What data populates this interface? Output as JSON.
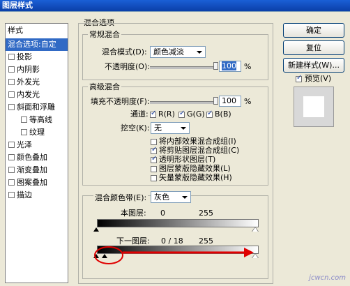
{
  "window": {
    "title": "图层样式"
  },
  "sidebar": {
    "header": "样式",
    "items": [
      {
        "label": "混合选项:自定",
        "selected": true,
        "checkbox": false
      },
      {
        "label": "投影",
        "checkbox": true,
        "checked": false
      },
      {
        "label": "内阴影",
        "checkbox": true,
        "checked": false
      },
      {
        "label": "外发光",
        "checkbox": true,
        "checked": false
      },
      {
        "label": "内发光",
        "checkbox": true,
        "checked": false
      },
      {
        "label": "斜面和浮雕",
        "checkbox": true,
        "checked": false
      },
      {
        "label": "等高线",
        "checkbox": true,
        "checked": false,
        "indent": true
      },
      {
        "label": "纹理",
        "checkbox": true,
        "checked": false,
        "indent": true
      },
      {
        "label": "光泽",
        "checkbox": true,
        "checked": false
      },
      {
        "label": "颜色叠加",
        "checkbox": true,
        "checked": false
      },
      {
        "label": "渐变叠加",
        "checkbox": true,
        "checked": false
      },
      {
        "label": "图案叠加",
        "checkbox": true,
        "checked": false
      },
      {
        "label": "描边",
        "checkbox": true,
        "checked": false
      }
    ]
  },
  "blend_options": {
    "title": "混合选项",
    "general": {
      "title": "常规混合",
      "mode_label": "混合模式(D):",
      "mode_value": "颜色减淡",
      "opacity_label": "不透明度(O):",
      "opacity_value": "100",
      "opacity_unit": "%",
      "opacity_level": 1.0
    },
    "advanced": {
      "title": "高级混合",
      "fill_label": "填充不透明度(F):",
      "fill_value": "100",
      "fill_unit": "%",
      "fill_level": 1.0,
      "channels_label": "通道:",
      "channels": [
        {
          "label": "R(R)",
          "checked": true
        },
        {
          "label": "G(G)",
          "checked": true
        },
        {
          "label": "B(B)",
          "checked": true
        }
      ],
      "knockout_label": "挖空(K):",
      "knockout_value": "无",
      "options": [
        {
          "label": "将内部效果混合成组(I)",
          "checked": false
        },
        {
          "label": "将剪贴图层混合成组(C)",
          "checked": true
        },
        {
          "label": "透明形状图层(T)",
          "checked": true
        },
        {
          "label": "图层蒙版隐藏效果(L)",
          "checked": false
        },
        {
          "label": "矢量蒙版隐藏效果(H)",
          "checked": false
        }
      ]
    },
    "blend_if": {
      "label": "混合颜色带(E):",
      "value": "灰色",
      "this_layer_label": "本图层:",
      "this_layer_min": "0",
      "this_layer_max": "255",
      "underlying_label": "下一图层:",
      "underlying_values": "0  /  18",
      "underlying_max": "255"
    }
  },
  "buttons": {
    "ok": "确定",
    "reset": "复位",
    "new_style": "新建样式(W)...",
    "preview_label": "预览(V)",
    "preview_checked": true
  },
  "watermark": "jcwcn.com"
}
